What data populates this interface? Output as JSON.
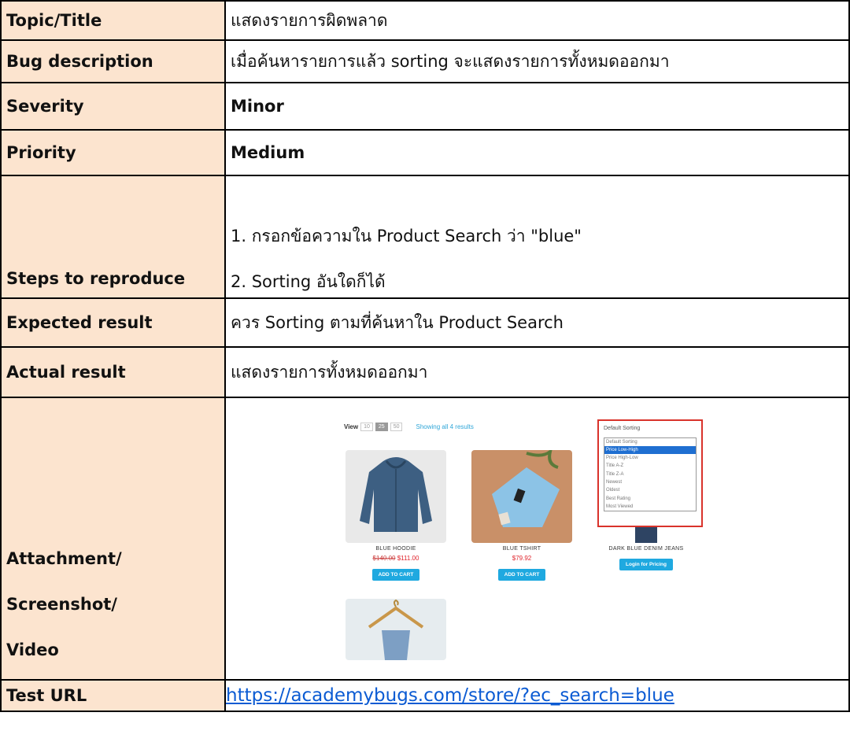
{
  "rows": {
    "topic": {
      "label": "Topic/Title",
      "value": "แสดงรายการผิดพลาด"
    },
    "bug_description": {
      "label": "Bug description",
      "value": "เมื่อค้นหารายการแล้ว sorting จะแสดงรายการทั้งหมดออกมา"
    },
    "severity": {
      "label": "Severity",
      "value": "Minor"
    },
    "priority": {
      "label": "Priority",
      "value": "Medium"
    },
    "steps": {
      "label": "Steps to reproduce",
      "items": [
        "1. กรอกข้อความใน Product Search ว่า \"blue\"",
        "2. Sorting อันใดก็ได้"
      ]
    },
    "expected": {
      "label": "Expected result",
      "value": "ควร Sorting ตามที่ค้นหาใน Product Search"
    },
    "actual": {
      "label": "Actual result",
      "value": "แสดงรายการทั้งหมดออกมา"
    },
    "attachment": {
      "label_lines": [
        "Attachment/",
        "Screenshot/",
        "Video"
      ]
    },
    "test_url": {
      "label": "Test URL",
      "value": "https://academybugs.com/store/?ec_search=blue"
    }
  },
  "screenshot": {
    "view_label": "View",
    "page_sizes": [
      "10",
      "25",
      "50"
    ],
    "showing": "Showing all 4 results",
    "products": [
      {
        "name": "BLUE HOODIE",
        "old_price": "$140.00",
        "price": "$111.00",
        "button": "ADD TO CART"
      },
      {
        "name": "BLUE TSHIRT",
        "price": "$79.92",
        "button": "ADD TO CART"
      },
      {
        "name": "DARK BLUE DENIM JEANS",
        "button": "Login for Pricing"
      }
    ],
    "sort_dropdown": {
      "current": "Default Sorting",
      "options": [
        "Default Sorting",
        "Price Low-High",
        "Price High-Low",
        "Title A-Z",
        "Title Z-A",
        "Newest",
        "Oldest",
        "Best Rating",
        "Most Viewed"
      ],
      "highlighted": "Price Low-High"
    }
  },
  "colors": {
    "label_bg": "#fce4cf",
    "border": "#000000",
    "link": "#0b5bd3",
    "highlight_box": "#d9332b"
  }
}
